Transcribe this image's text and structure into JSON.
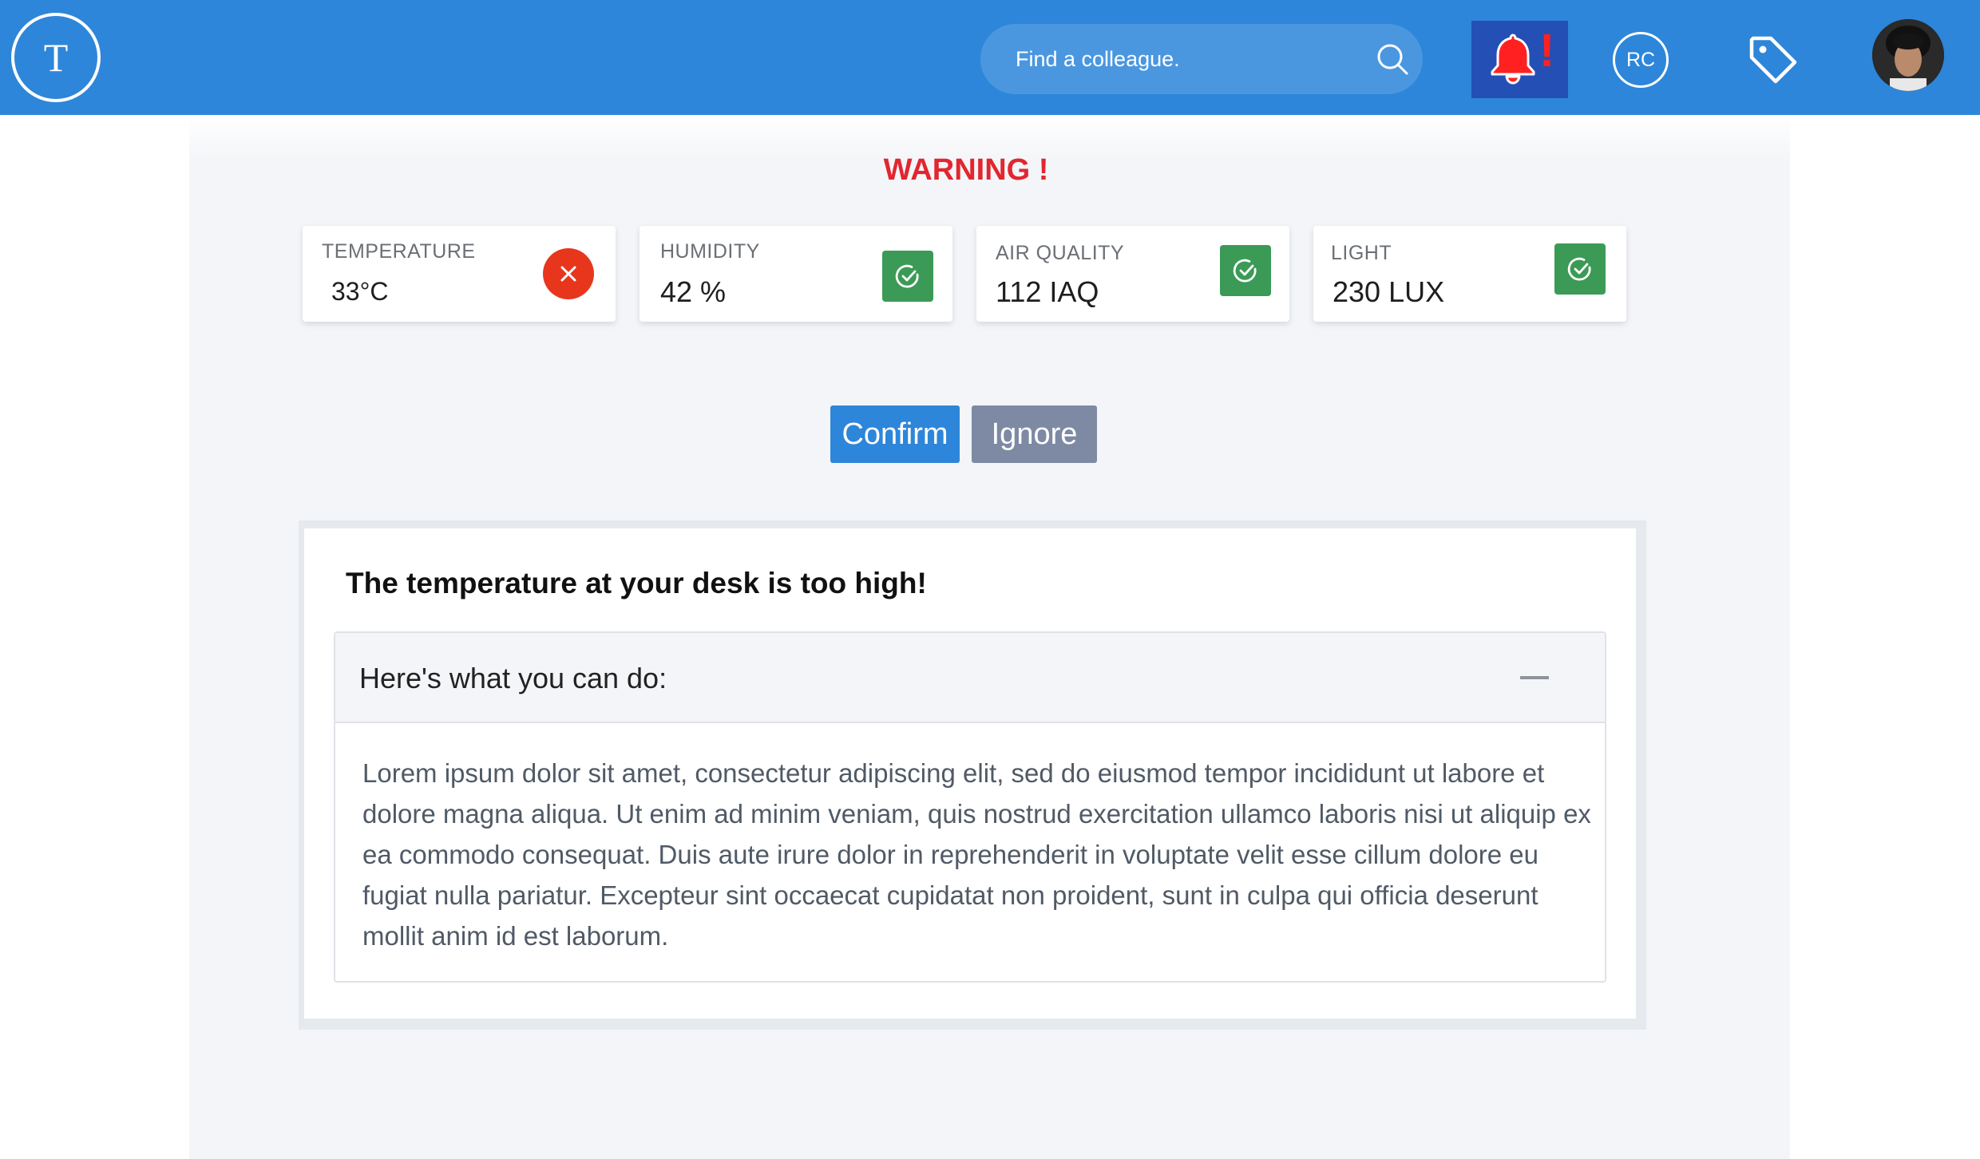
{
  "header": {
    "logo_letter": "T",
    "search_placeholder": "Find a colleague.",
    "notification_alert": "!",
    "user_initials": "RC",
    "colors": {
      "bar": "#2d86d9",
      "bell_button": "#244fb4",
      "bell": "#ff2121"
    }
  },
  "warning": "WARNING !",
  "metrics": [
    {
      "label": "TEMPERATURE",
      "value": "33°C",
      "status": "error",
      "icon": "x-circle-icon"
    },
    {
      "label": "HUMIDITY",
      "value": "42 %",
      "status": "ok",
      "icon": "check-circle-icon"
    },
    {
      "label": "AIR QUALITY",
      "value": "112 IAQ",
      "status": "ok",
      "icon": "check-circle-icon"
    },
    {
      "label": "LIGHT",
      "value": "230 LUX",
      "status": "ok",
      "icon": "check-circle-icon"
    }
  ],
  "actions": {
    "confirm": "Confirm",
    "ignore": "Ignore"
  },
  "advice": {
    "title": "The temperature at your desk is too high!",
    "section_title": "Here's what you can do:",
    "body": "Lorem ipsum dolor sit amet, consectetur adipiscing elit, sed do eiusmod tempor incididunt ut labore et dolore magna aliqua. Ut enim ad minim veniam, quis nostrud exercitation ullamco laboris nisi ut aliquip ex ea commodo consequat. Duis aute irure dolor in reprehenderit in voluptate velit esse cillum dolore eu fugiat nulla pariatur. Excepteur sint occaecat cupidatat non proident, sunt in culpa qui officia deserunt mollit anim id est laborum."
  }
}
